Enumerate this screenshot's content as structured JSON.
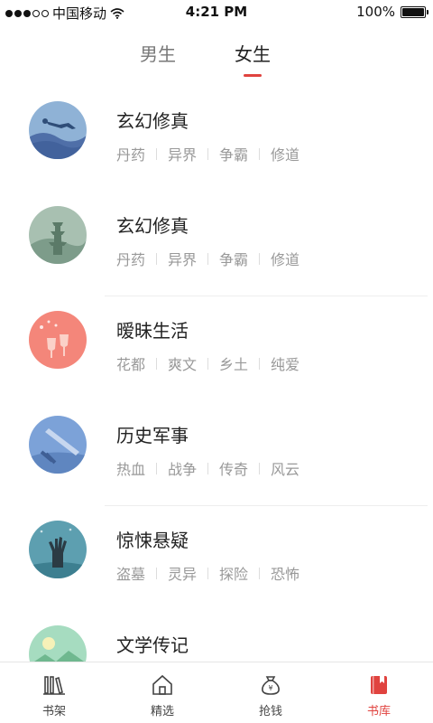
{
  "status_bar": {
    "carrier": "中国移动",
    "time": "4:21 PM",
    "battery": "100%"
  },
  "tabs": [
    {
      "label": "男生",
      "selected": false
    },
    {
      "label": "女生",
      "selected": true
    }
  ],
  "categories": [
    {
      "title": "玄幻修真",
      "tags": [
        "丹药",
        "异界",
        "争霸",
        "修道"
      ],
      "icon": "diver-icon"
    },
    {
      "title": "玄幻修真",
      "tags": [
        "丹药",
        "异界",
        "争霸",
        "修道"
      ],
      "icon": "pagoda-icon"
    },
    {
      "title": "暧昧生活",
      "tags": [
        "花都",
        "爽文",
        "乡土",
        "纯爱"
      ],
      "icon": "wine-glasses-icon"
    },
    {
      "title": "历史军事",
      "tags": [
        "热血",
        "战争",
        "传奇",
        "风云"
      ],
      "icon": "sword-icon"
    },
    {
      "title": "惊悚悬疑",
      "tags": [
        "盗墓",
        "灵异",
        "探险",
        "恐怖"
      ],
      "icon": "zombie-hand-icon"
    },
    {
      "title": "文学传记",
      "tags": [],
      "icon": "landscape-icon"
    }
  ],
  "bottom_nav": [
    {
      "label": "书架",
      "icon": "bookshelf-icon",
      "active": false
    },
    {
      "label": "精选",
      "icon": "home-icon",
      "active": false
    },
    {
      "label": "抢钱",
      "icon": "money-bag-icon",
      "active": false
    },
    {
      "label": "书库",
      "icon": "library-icon",
      "active": true
    }
  ],
  "colors": {
    "accent": "#e0433f",
    "text_primary": "#222222",
    "text_secondary": "#999999"
  }
}
